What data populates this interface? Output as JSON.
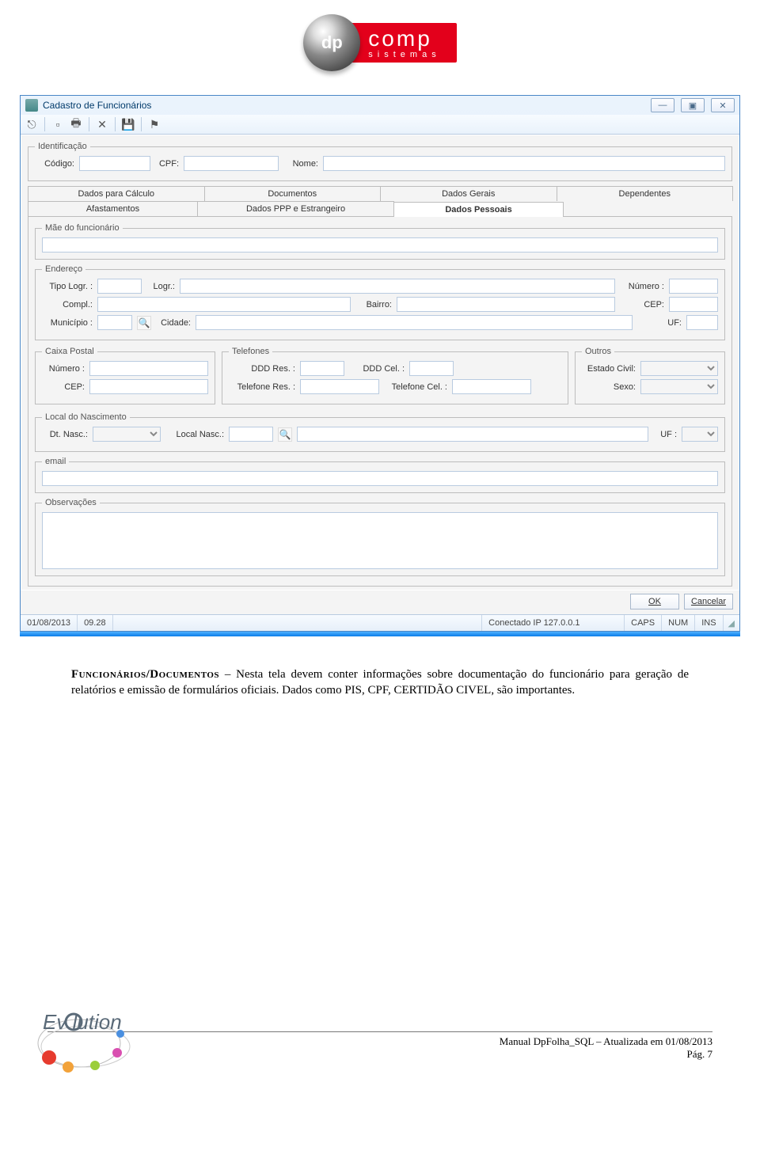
{
  "logo": {
    "ball": "dp",
    "word": "comp",
    "sub": "sistemas"
  },
  "window": {
    "title": "Cadastro de Funcionários",
    "buttons_icons": {
      "min": "—",
      "max": "▣",
      "close": "✕"
    }
  },
  "ident": {
    "legend": "Identificação",
    "codigo_label": "Código:",
    "cpf_label": "CPF:",
    "nome_label": "Nome:"
  },
  "tabs_row1": [
    "Dados para Cálculo",
    "Documentos",
    "Dados Gerais",
    "Dependentes"
  ],
  "tabs_row2": [
    "Afastamentos",
    "Dados PPP e Estrangeiro",
    "Dados Pessoais"
  ],
  "tabs_row2_active_index": 2,
  "grp_mae": {
    "legend": "Mãe do funcionário"
  },
  "grp_end": {
    "legend": "Endereço",
    "tipo_logr": "Tipo Logr. :",
    "logr": "Logr.:",
    "numero": "Número :",
    "compl": "Compl.:",
    "bairro": "Bairro:",
    "cep": "CEP:",
    "municipio": "Município :",
    "cidade": "Cidade:",
    "uf": "UF:"
  },
  "grp_cxpostal": {
    "legend": "Caixa Postal",
    "numero": "Número :",
    "cep": "CEP:"
  },
  "grp_tel": {
    "legend": "Telefones",
    "ddd_res": "DDD Res. :",
    "ddd_cel": "DDD Cel. :",
    "tel_res": "Telefone Res. :",
    "tel_cel": "Telefone Cel. :"
  },
  "grp_outros": {
    "legend": "Outros",
    "estado": "Estado Civil:",
    "sexo": "Sexo:"
  },
  "grp_localnasc": {
    "legend": "Local do Nascimento",
    "dtnasc": "Dt. Nasc.:",
    "local": "Local Nasc.:",
    "uf": "UF :"
  },
  "grp_email": {
    "legend": "email"
  },
  "grp_obs": {
    "legend": "Observações"
  },
  "dlg": {
    "ok": "OK",
    "cancel": "Cancelar"
  },
  "status": {
    "date": "01/08/2013",
    "time": "09.28",
    "conn": "Conectado IP 127.0.0.1",
    "caps": "CAPS",
    "num": "NUM",
    "ins": "INS"
  },
  "body": {
    "heading": "Funcionários/Documentos",
    "text": " – Nesta tela devem conter informações sobre documentação do funcionário para geração de relatórios e emissão de formulários oficiais. Dados como PIS, CPF, CERTIDÃO CIVEL, são importantes."
  },
  "footer": {
    "line1": "Manual DpFolha_SQL – Atualizada em 01/08/2013",
    "line2": "Pág. 7"
  },
  "ev_logo_text": "Ev   lution"
}
